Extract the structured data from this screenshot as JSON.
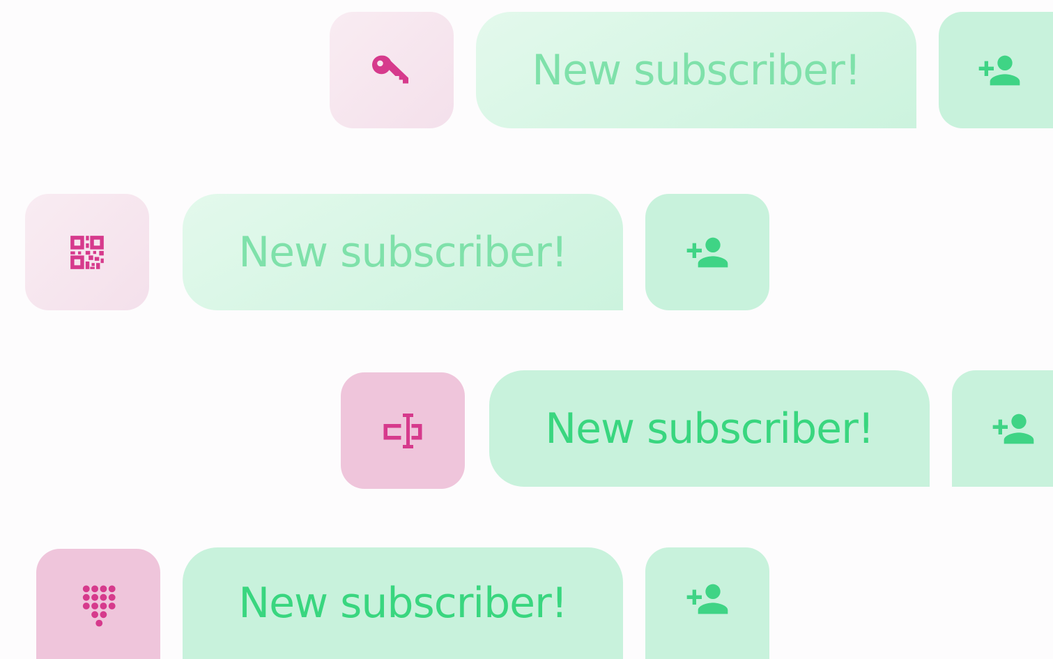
{
  "colors": {
    "pink_icon": "#d63a8c",
    "green_icon": "#3fd485",
    "green_text_faded": "#7fe1aa",
    "green_text_solid": "#39d67f",
    "pink_tile_light": "#f6e4ee",
    "pink_tile_strong": "#efc5db",
    "green_bg": "#c8f2dc"
  },
  "rows": [
    {
      "icon": "key-icon",
      "message": "New subscriber!",
      "action_icon": "person-add-icon"
    },
    {
      "icon": "qr-code-icon",
      "message": "New subscriber!",
      "action_icon": "person-add-icon"
    },
    {
      "icon": "text-cursor-box-icon",
      "message": "New subscriber!",
      "action_icon": "person-add-icon"
    },
    {
      "icon": "dialpad-icon",
      "message": "New subscriber!",
      "action_icon": "person-add-icon"
    }
  ]
}
